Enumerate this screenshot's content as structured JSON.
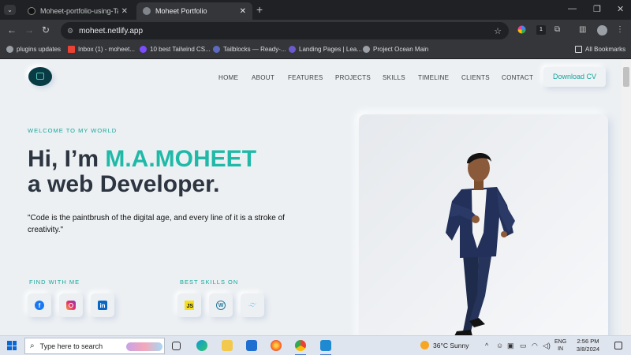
{
  "browser": {
    "tabs": [
      {
        "title": "Moheet-portfolio-using-Tailwin",
        "active": false
      },
      {
        "title": "Moheet Portfolio",
        "active": true
      }
    ],
    "new_tab_glyph": "+",
    "close_glyph": "✕",
    "window_controls": {
      "minimize": "—",
      "restore": "❐",
      "close": "✕"
    },
    "url": "moheet.netlify.app",
    "extension_badge": "1",
    "bookmarks": [
      {
        "label": "plugins updates",
        "icon": "globe-icon"
      },
      {
        "label": "Inbox (1) - moheet...",
        "icon": "gmail-icon"
      },
      {
        "label": "10 best Tailwind CS...",
        "icon": "tailwind-bookmark-icon"
      },
      {
        "label": "Tailblocks — Ready-...",
        "icon": "tailblocks-icon"
      },
      {
        "label": "Landing Pages | Lea...",
        "icon": "landing-pages-icon"
      },
      {
        "label": "Project Ocean Main",
        "icon": "globe-icon"
      }
    ],
    "all_bookmarks": "All Bookmarks"
  },
  "site": {
    "nav": [
      "HOME",
      "ABOUT",
      "FEATURES",
      "PROJECTS",
      "SKILLS",
      "TIMELINE",
      "CLIENTS",
      "CONTACT"
    ],
    "cv_button": "Download CV",
    "welcome": "WELCOME TO MY WORLD",
    "hero_prefix": "Hi, I’m ",
    "hero_name": "M.A.MOHEET",
    "hero_role": "a web Developer.",
    "quote": "\"Code is the paintbrush of the digital age, and every line of it is a stroke of creativity.\"",
    "find_label": "FIND WITH ME",
    "skills_label": "BEST SKILLS ON",
    "social_icons": [
      "facebook-icon",
      "instagram-icon",
      "linkedin-icon"
    ],
    "skill_icons": [
      "javascript-icon",
      "wordpress-icon",
      "tailwind-icon"
    ],
    "js_badge_text": "JS",
    "linkedin_text": "in"
  },
  "taskbar": {
    "search_placeholder": "Type here to search",
    "weather": "36°C  Sunny",
    "lang_top": "ENG",
    "lang_bottom": "IN",
    "time": "2:56 PM",
    "date": "3/8/2024"
  },
  "colors": {
    "accent": "#20b9a8",
    "heading": "#2d3541",
    "page_bg": "#ecf0f3"
  }
}
